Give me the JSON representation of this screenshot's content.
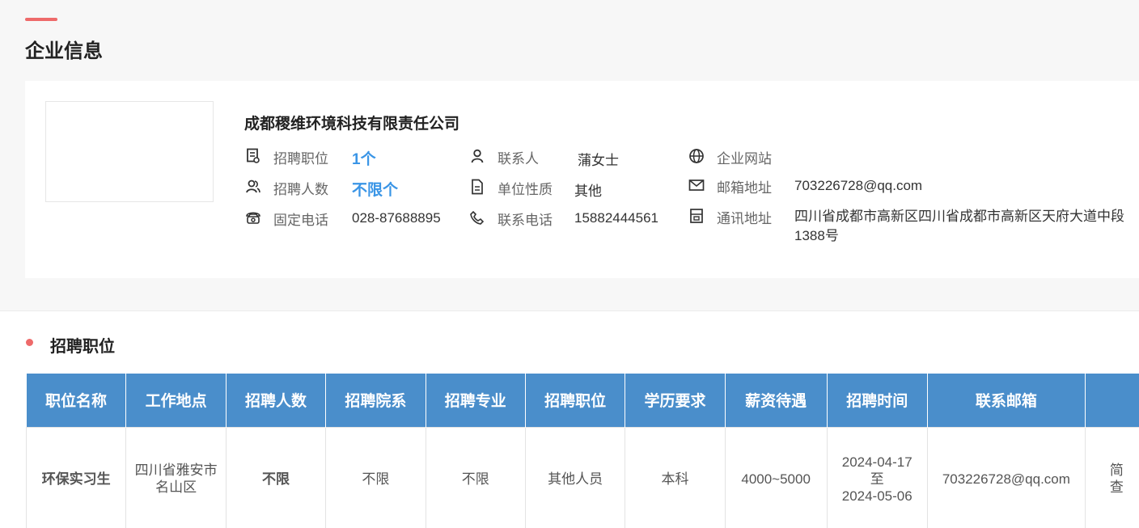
{
  "header": {
    "title": "企业信息"
  },
  "company": {
    "name": "成都稷维环境科技有限责任公司",
    "positions_label": "招聘职位",
    "positions_value": "1个",
    "headcount_label": "招聘人数",
    "headcount_value": "不限个",
    "phone_label": "固定电话",
    "phone_value": "028-87688895",
    "contact_label": "联系人",
    "contact_value": "蒲女士",
    "unit_type_label": "单位性质",
    "unit_type_value": "其他",
    "mobile_label": "联系电话",
    "mobile_value": "15882444561",
    "website_label": "企业网站",
    "website_value": "",
    "email_label": "邮箱地址",
    "email_value": "703226728@qq.com",
    "address_label": "通讯地址",
    "address_value": "四川省成都市高新区四川省成都市高新区天府大道中段1388号"
  },
  "jobs": {
    "title": "招聘职位",
    "columns": [
      "职位名称",
      "工作地点",
      "招聘人数",
      "招聘院系",
      "招聘专业",
      "招聘职位",
      "学历要求",
      "薪资待遇",
      "招聘时间",
      "联系邮箱",
      ""
    ],
    "rows": [
      {
        "name": "环保实习生",
        "location": "四川省雅安市名山区",
        "headcount": "不限",
        "department": "不限",
        "major": "不限",
        "position": "其他人员",
        "education": "本科",
        "salary": "4000~5000",
        "date_start": "2024-04-17",
        "date_sep": "至",
        "date_end": "2024-05-06",
        "email": "703226728@qq.com",
        "action_1": "简",
        "action_2": "查"
      }
    ]
  },
  "colors": {
    "accent": "#ee6a6a",
    "header_blue": "#4a8ecb",
    "link_blue": "#3a95e6"
  }
}
